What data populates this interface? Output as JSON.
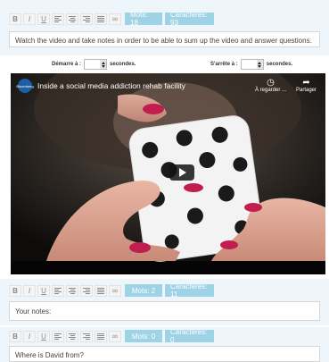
{
  "editor1": {
    "toolbar": {
      "bold": "B",
      "italic": "I",
      "underline": "U",
      "link": "∞"
    },
    "words_label": "Mots: 18",
    "chars_label": "Caractères: 93"
  },
  "instructions_text": "Watch the video and take notes in order to be able to sum up the video and answer questions.",
  "time": {
    "start_label": "Démarre à :",
    "end_label": "S'arrête à :",
    "unit": "secondes.",
    "start_value": "",
    "end_value": ""
  },
  "video": {
    "channel_logo": "Bloomberg",
    "title": "Inside a social media addiction rehab facility",
    "watch_later_label": "À regarder ...",
    "share_label": "Partager"
  },
  "editor2": {
    "toolbar": {
      "bold": "B",
      "italic": "I",
      "underline": "U",
      "link": "∞"
    },
    "words_label": "Mots: 2",
    "chars_label": "Caractères: 11",
    "text": "Your notes:"
  },
  "editor3": {
    "toolbar": {
      "bold": "B",
      "italic": "I",
      "underline": "U",
      "link": "∞"
    },
    "words_label": "Mots: 0",
    "chars_label": "Caractères: 0",
    "text": "Where is David from?"
  },
  "colors": {
    "badge": "#9ed3e6",
    "panel": "#eef6fb"
  }
}
